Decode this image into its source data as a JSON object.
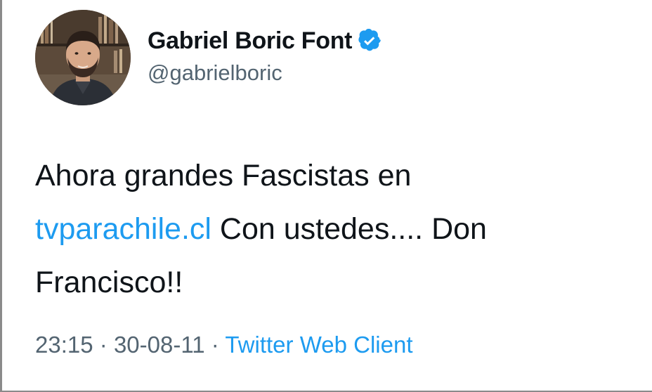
{
  "tweet": {
    "display_name": "Gabriel Boric Font",
    "handle": "@gabrielboric",
    "verified_icon": "verified-badge-icon",
    "text_before": "Ahora grandes Fascistas en",
    "link": "tvparachile.cl",
    "text_after": " Con ustedes.... Don Francisco!!",
    "time": "23:15",
    "separator": "·",
    "date": "30-08-11",
    "source": "Twitter Web Client"
  },
  "colors": {
    "link": "#1d9bf0",
    "secondary_text": "#536471",
    "primary_text": "#0f1419",
    "verified": "#1d9bf0"
  }
}
